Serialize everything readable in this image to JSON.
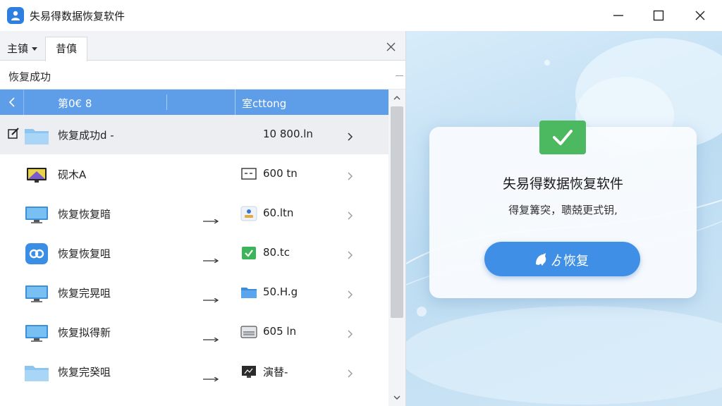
{
  "window": {
    "title": "失易得数据恢复软件"
  },
  "tabs": {
    "main_label": "主镇",
    "active_label": "昔傎"
  },
  "section": {
    "label": "恢复成功"
  },
  "table": {
    "col1": "第0€ 8",
    "col2": "室cttong",
    "rows": [
      {
        "name": "恢复成功d -",
        "size": "10 800.ln",
        "icon": "folder-icon",
        "size_icon": "none",
        "arrow": false,
        "check": true,
        "selected": true
      },
      {
        "name": "砚木A",
        "size": "600 tn",
        "icon": "monitor-icon",
        "size_icon": "window-icon",
        "arrow": false,
        "check": false,
        "selected": false
      },
      {
        "name": "恢复恢复暗",
        "size": "60.ltn",
        "icon": "desktop-icon",
        "size_icon": "user-app-icon",
        "arrow": true,
        "check": false,
        "selected": false
      },
      {
        "name": "恢复恢复咀",
        "size": "80.tc",
        "icon": "link-app-icon",
        "size_icon": "green-check-icon",
        "arrow": true,
        "check": false,
        "selected": false
      },
      {
        "name": "恢复完晃咀",
        "size": "50.H.g",
        "icon": "desktop-icon",
        "size_icon": "blue-folder-icon",
        "arrow": true,
        "check": false,
        "selected": false
      },
      {
        "name": "恢复拟得新",
        "size": "605 ln",
        "icon": "desktop-icon",
        "size_icon": "drive-icon",
        "arrow": true,
        "check": false,
        "selected": false
      },
      {
        "name": "恢复完癸咀",
        "size": "演替-",
        "icon": "folder-icon",
        "size_icon": "dark-monitor-icon",
        "arrow": true,
        "check": false,
        "selected": false
      }
    ]
  },
  "card": {
    "title": "失易得数据恢复软件",
    "subtitle": "得复篝突，聩兢更式钥,",
    "button_label": "ゟ恢复",
    "badge_icon": "check-icon"
  },
  "colors": {
    "accent": "#3f8fe6",
    "header_blue": "#5e9de8",
    "success_green": "#4cb860"
  }
}
